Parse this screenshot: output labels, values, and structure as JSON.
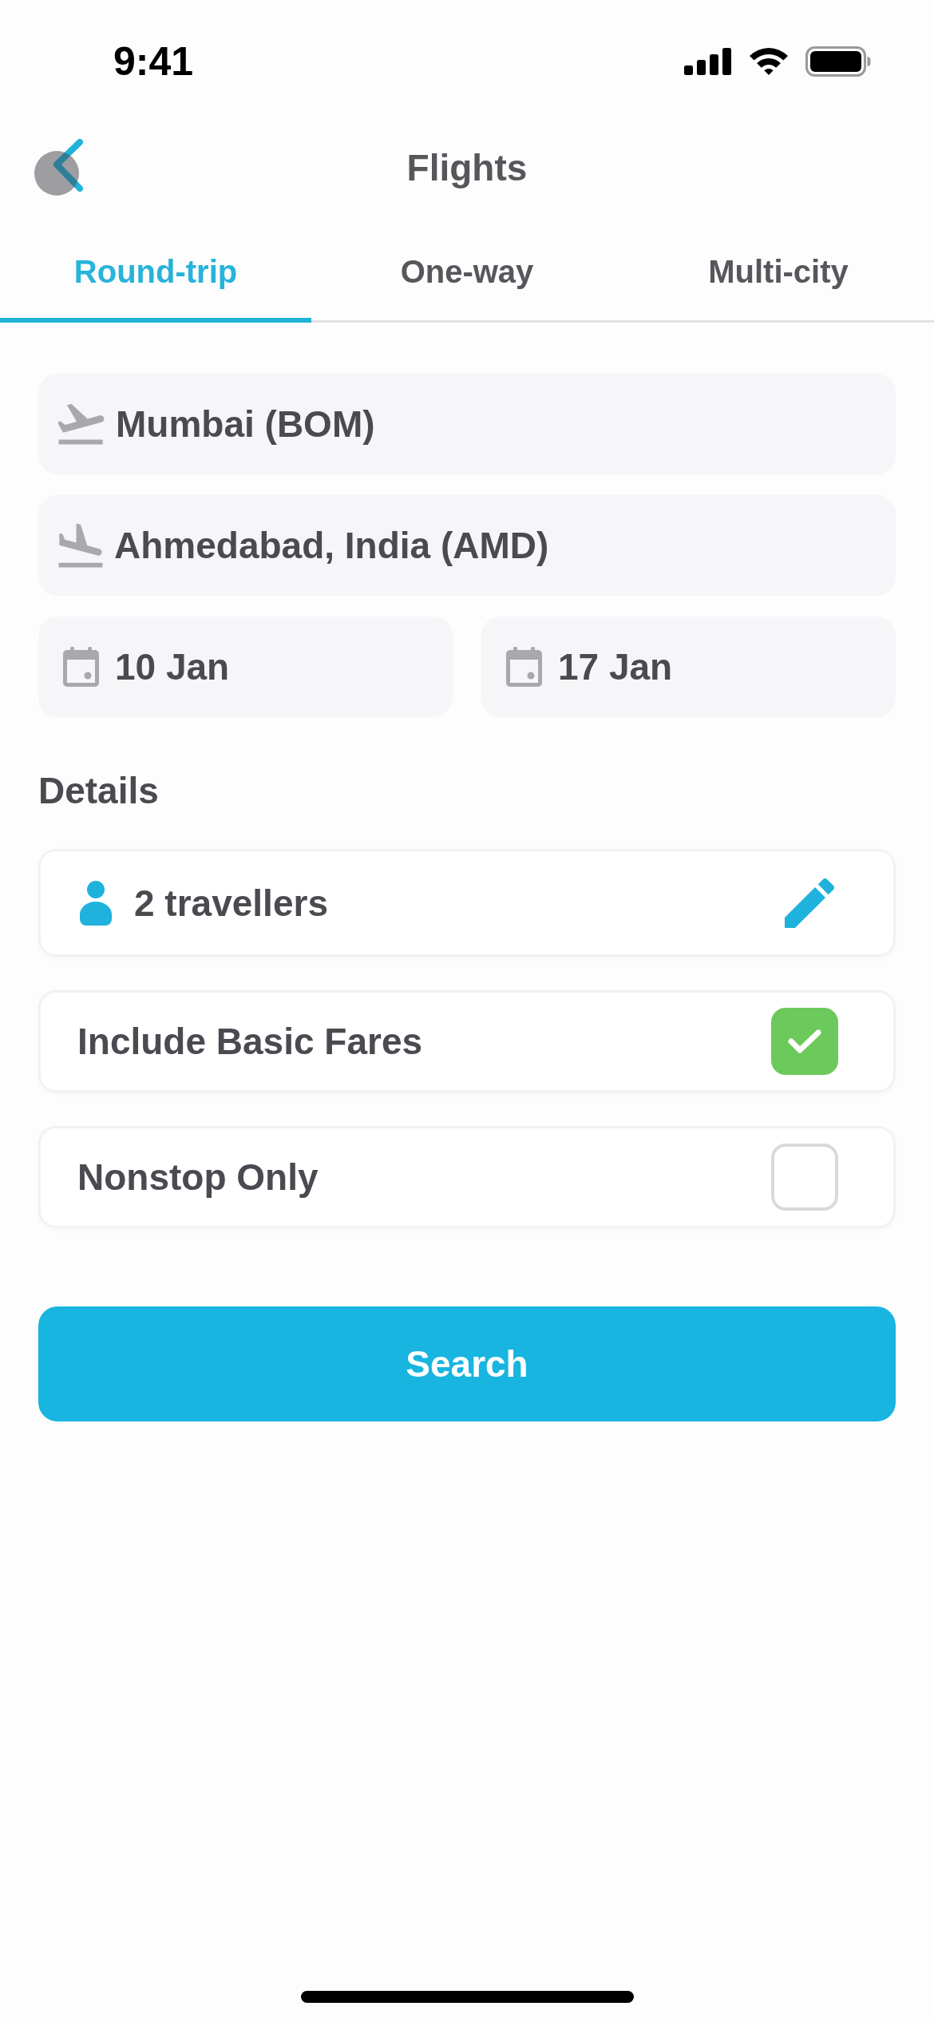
{
  "status_bar": {
    "time": "9:41"
  },
  "header": {
    "title": "Flights"
  },
  "tabs": [
    {
      "label": "Round-trip",
      "selected": true
    },
    {
      "label": "One-way",
      "selected": false
    },
    {
      "label": "Multi-city",
      "selected": false
    }
  ],
  "route": [
    {
      "kind": "departure",
      "value": "Mumbai (BOM)"
    },
    {
      "kind": "arrival",
      "value": "Ahmedabad, India (AMD)"
    }
  ],
  "dates": [
    {
      "value": "10 Jan"
    },
    {
      "value": "17 Jan"
    }
  ],
  "details": {
    "heading": "Details",
    "travellers": "2 travellers",
    "options": [
      {
        "label": "Include Basic Fares",
        "checked": true
      },
      {
        "label": "Nonstop Only",
        "checked": false
      }
    ]
  },
  "search_button": {
    "label": "Search"
  }
}
